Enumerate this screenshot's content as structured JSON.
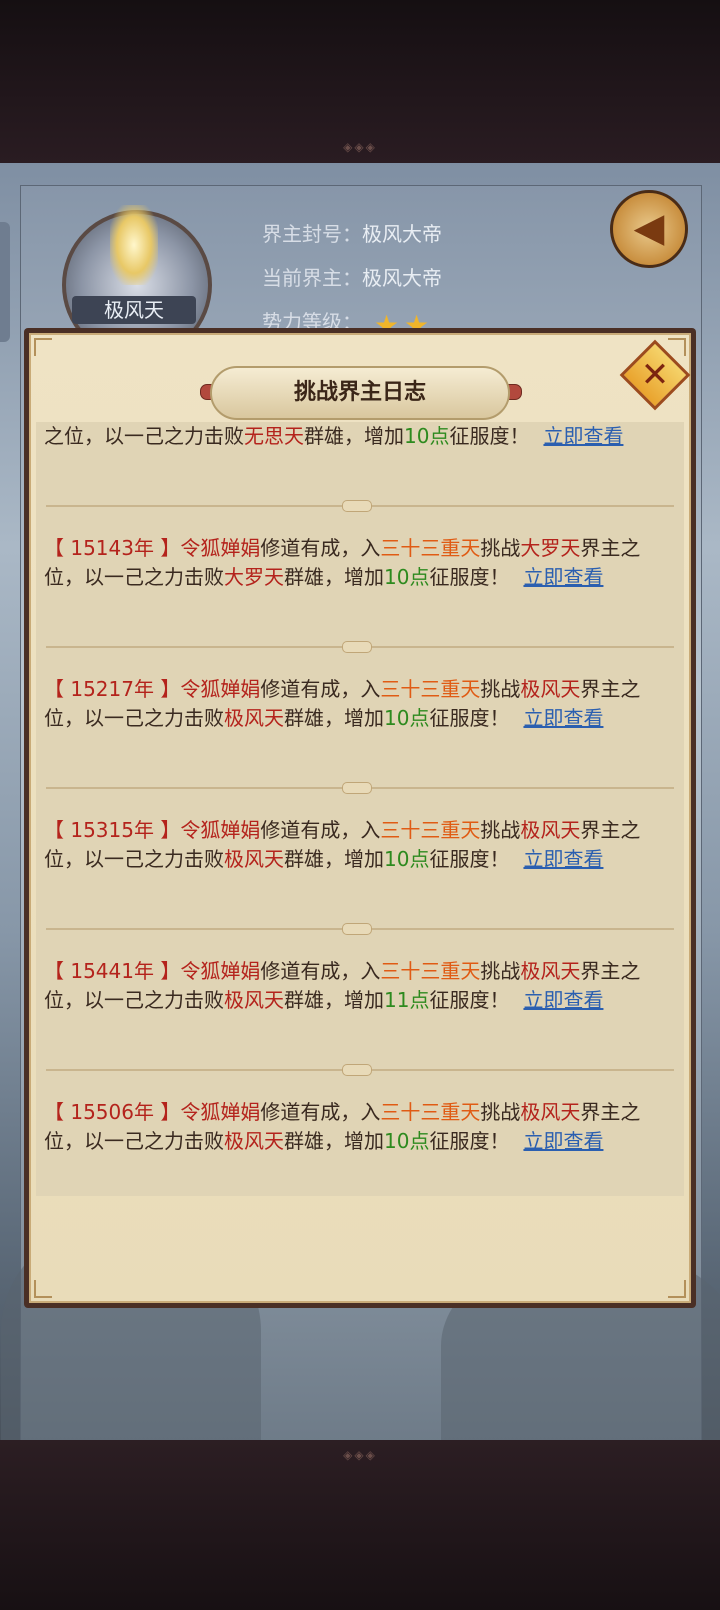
{
  "header": {
    "avatar_name": "极风天",
    "title_label": "界主封号：",
    "title_value": "极风大帝",
    "current_label": "当前界主：",
    "current_value": "极风大帝",
    "level_label": "势力等级：",
    "level_stars": 2
  },
  "dialog": {
    "title": "挑战界主日志",
    "close_symbol": "✕",
    "view_link": "立即查看",
    "partial_entry": {
      "line_start": "之位，以一己之力击败",
      "realm": "无思天",
      "mid": "群雄，增加",
      "points": "10点",
      "end": "征服度！"
    },
    "entries": [
      {
        "year": "【 15143年 】",
        "name": "令狐婵娟",
        "text1": "修道有成，入",
        "place": "三十三重天",
        "text2": "挑战",
        "target": "大罗天",
        "text3": "界主之位，以一己之力击败",
        "realm": "大罗天",
        "text4": "群雄，增加",
        "points": "10点",
        "text5": "征服度！"
      },
      {
        "year": "【 15217年 】",
        "name": "令狐婵娟",
        "text1": "修道有成，入",
        "place": "三十三重天",
        "text2": "挑战",
        "target": "极风天",
        "text3": "界主之位，以一己之力击败",
        "realm": "极风天",
        "text4": "群雄，增加",
        "points": "10点",
        "text5": "征服度！"
      },
      {
        "year": "【 15315年 】",
        "name": "令狐婵娟",
        "text1": "修道有成，入",
        "place": "三十三重天",
        "text2": "挑战",
        "target": "极风天",
        "text3": "界主之位，以一己之力击败",
        "realm": "极风天",
        "text4": "群雄，增加",
        "points": "10点",
        "text5": "征服度！"
      },
      {
        "year": "【 15441年 】",
        "name": "令狐婵娟",
        "text1": "修道有成，入",
        "place": "三十三重天",
        "text2": "挑战",
        "target": "极风天",
        "text3": "界主之位，以一己之力击败",
        "realm": "极风天",
        "text4": "群雄，增加",
        "points": "11点",
        "text5": "征服度！"
      },
      {
        "year": "【 15506年 】",
        "name": "令狐婵娟",
        "text1": "修道有成，入",
        "place": "三十三重天",
        "text2": "挑战",
        "target": "极风天",
        "text3": "界主之位，以一己之力击败",
        "realm": "极风天",
        "text4": "群雄，增加",
        "points": "10点",
        "text5": "征服度！"
      }
    ]
  },
  "colors": {
    "year": "#b4231c",
    "place": "#e05b14",
    "points": "#2d8a1e",
    "link": "#2b5fb0"
  }
}
